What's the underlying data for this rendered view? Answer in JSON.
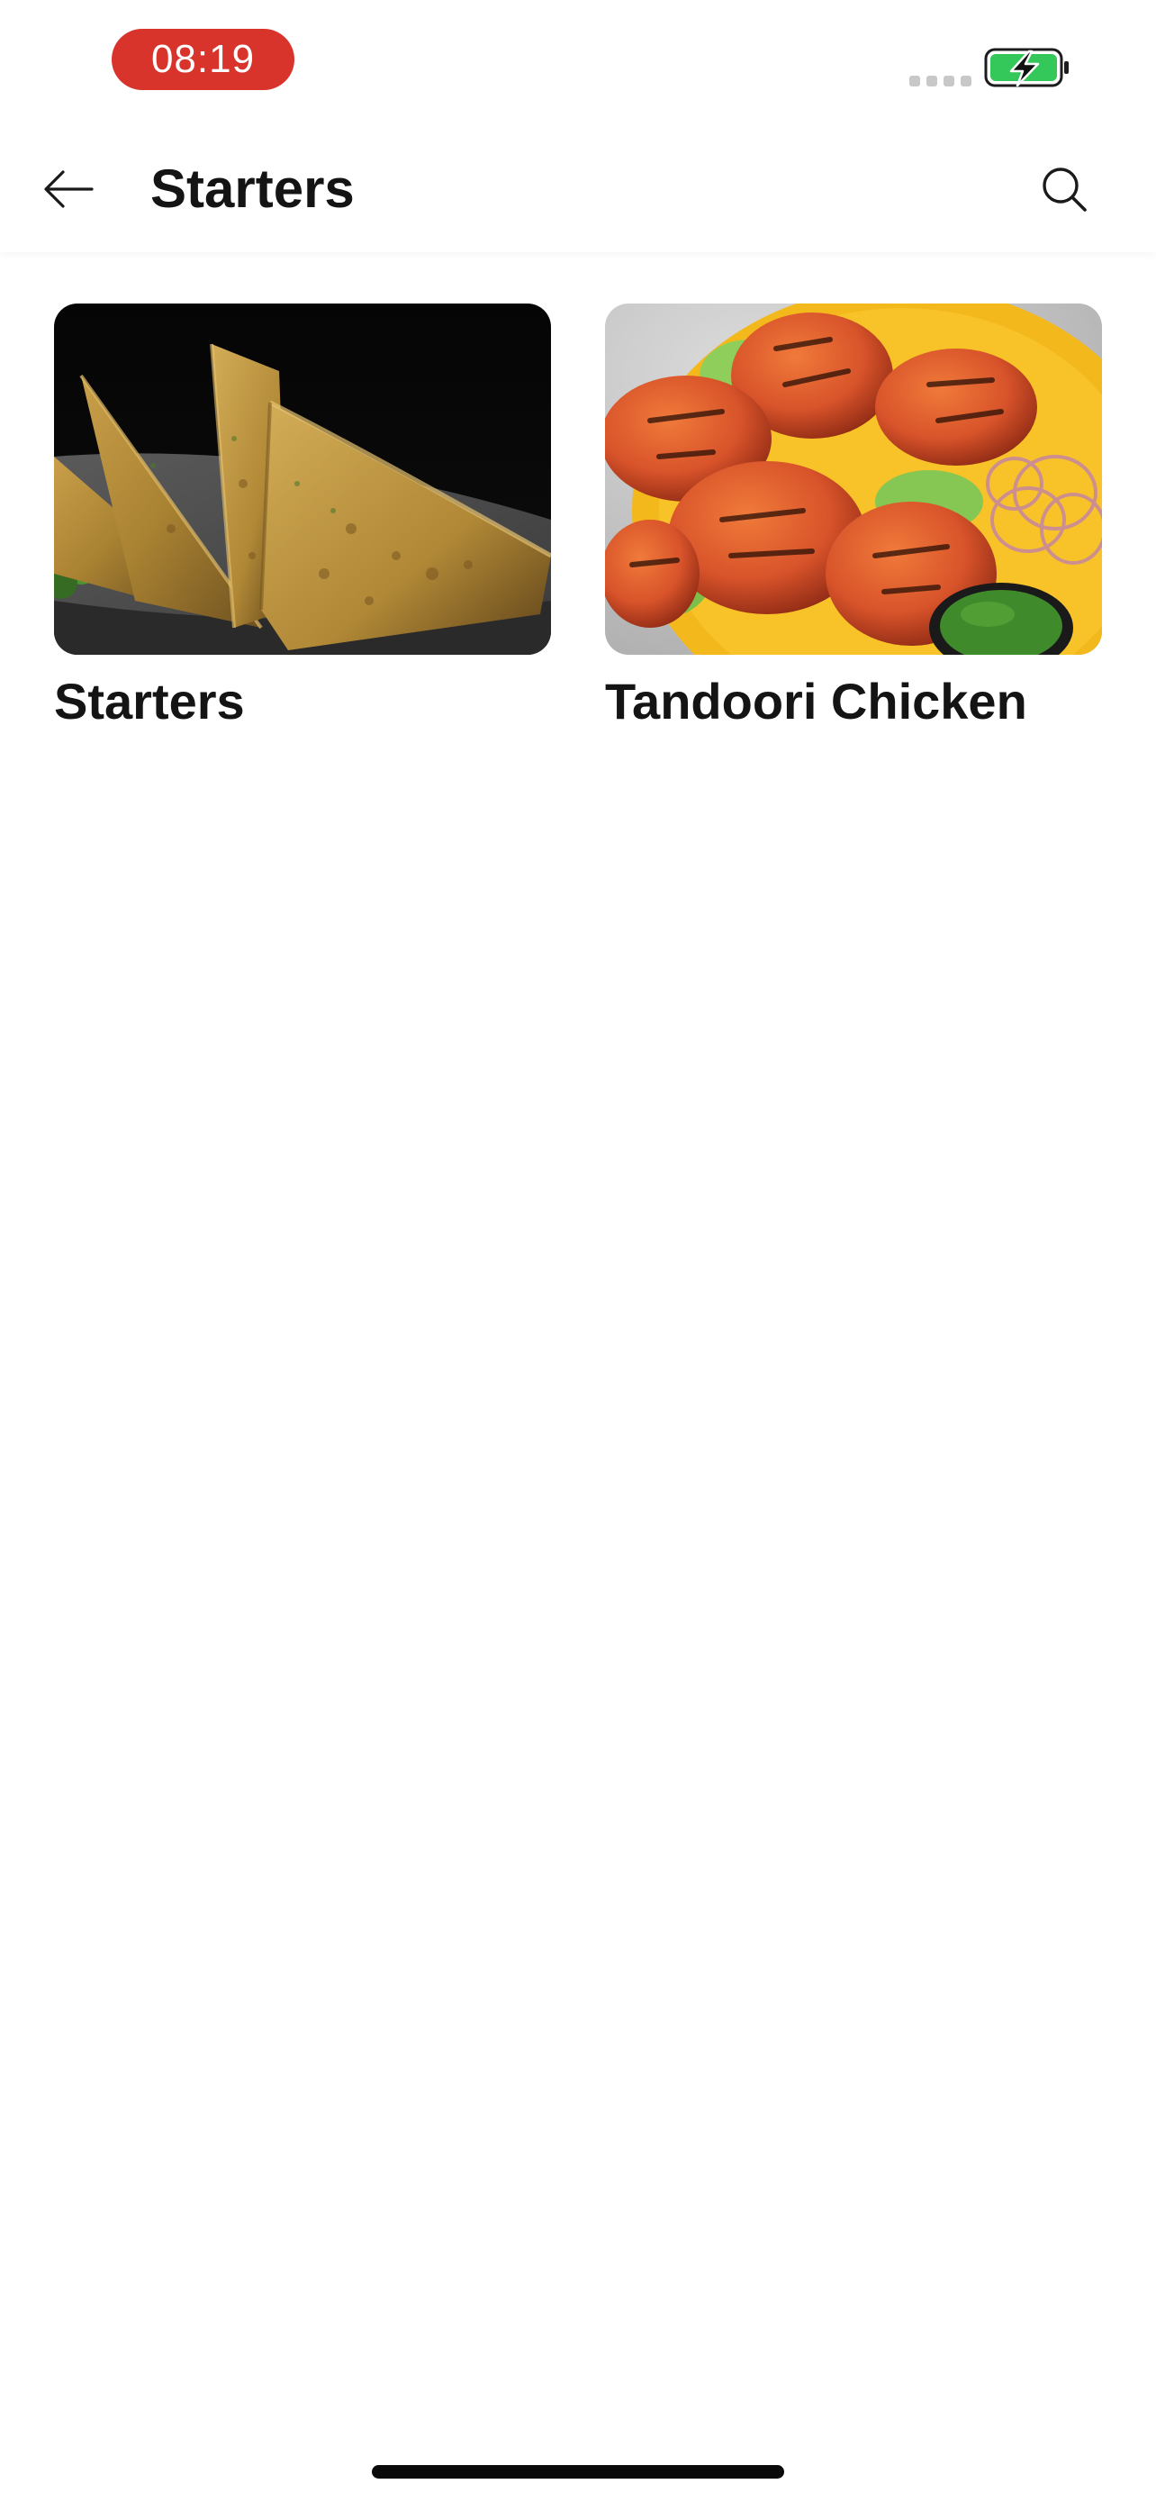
{
  "status_bar": {
    "time": "08:19",
    "time_pill_color": "#d8342b",
    "battery_state": "charging",
    "battery_color": "#34c759",
    "signal_icon": "signal-dots-icon",
    "battery_icon": "battery-charging-icon"
  },
  "header": {
    "title": "Starters",
    "back_icon": "arrow-left-icon",
    "search_icon": "search-icon"
  },
  "categories": [
    {
      "label": "Starters",
      "image_subject": "samosas"
    },
    {
      "label": "Tandoori Chicken",
      "image_subject": "tandoori chicken"
    }
  ]
}
